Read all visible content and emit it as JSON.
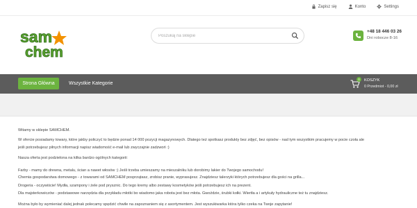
{
  "topbar": {
    "logout_label": "Zapisz się",
    "account_label": "Konto",
    "settings_label": "Settings"
  },
  "logo": {
    "line1": "sam",
    "line2": "chem"
  },
  "search": {
    "placeholder": "Poszukaj na sklepie"
  },
  "contact": {
    "phone": "+48 18 446 03 26",
    "hours": "Dni robocze 8-16"
  },
  "nav": {
    "home_label": "Strona Główna",
    "categories_label": "Wszystkie Kategorie"
  },
  "cart": {
    "title": "KOSZYK",
    "summary": "0 Przedmiot - 0,00 zł",
    "count": "0"
  },
  "colors": {
    "accent_green": "#6cb33f",
    "nav_gray": "#5c5c5c",
    "logo_orange": "#f39200"
  },
  "content": {
    "p1": "Witamy w sklepie SAMCHEM.",
    "p2": "W ofercie posiadamy towary, które jakby policzyć to będzie ponad 14 000 pozycji magazynowych. Dlatego też spotkasz produkty bez zdjęć, bez opisów - nad tym wszystkim pracujemy w pocie czoła ale",
    "p3": "jeśli potrzebujesz pilnych informacji napisz wiadomość e-mail lub zwyczajnie zadzwoń :)",
    "p4": "Nasza oferta jest podzielona na kilka bardzo ogólnych kategorii:",
    "p5": "Farby - mamy do drewna, metalu, ścian a nawet włosów :) Jeśli trzeba umieszamy na mieszalniku lub dorobimy lakier do Twojego samochodu!",
    "p6": "Chemia gospodarstwa domowego - z towarami od SAMCHEM posprzątasz, zrobisz pranie, wyprasujesz. Znajdziesz talerzyki których potrzebujesz dla gości na grilla...",
    "p7": "Drogeria - oczywiście! Mydła, szampony i żele pod prysznic. Do tego kremy albo zestawy kosmetyków jeśli potrzebujesz ich na prezent.",
    "p8": "Dla majsterkowiczów - podstawowe narzędzia dla przykładu młotki bo wiadomo jaka robota jest bez młota. Gwoździe, śrubki kołki. Wiertła a i artykuły hydrauliczne też tu znajdziesz.",
    "p9": "Można było by wymieniać dalej jednak polecamy spędzić chwile na zapoznaniem się z asortymentem. Jest wyszukiwarka która tylko czeka na Twoje zapytanie!"
  }
}
